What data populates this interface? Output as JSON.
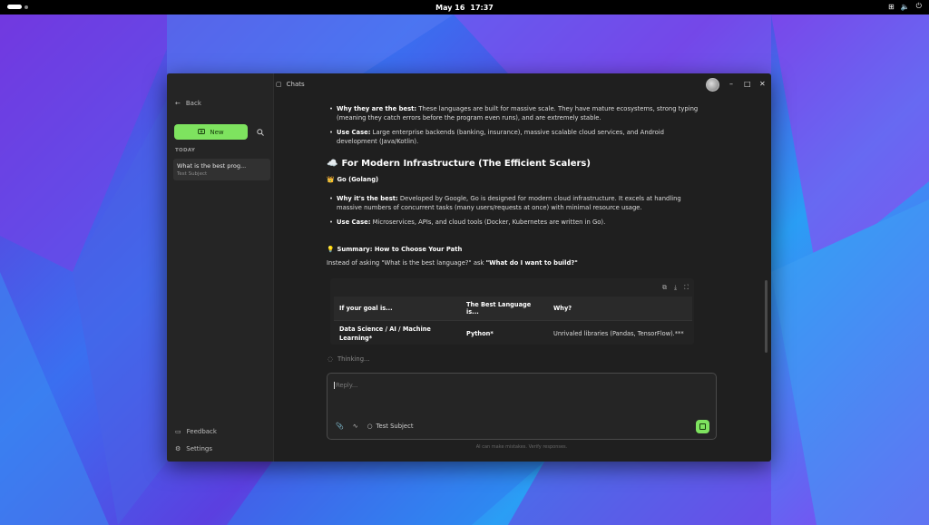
{
  "system": {
    "date": "May 16",
    "time": "17:37"
  },
  "sidebar": {
    "back_label": "Back",
    "new_label": "New",
    "section_today": "TODAY",
    "chats": [
      {
        "title": "What is the best prog...",
        "subtitle": "Test Subject"
      }
    ],
    "feedback_label": "Feedback",
    "settings_label": "Settings"
  },
  "header": {
    "title": "Chats"
  },
  "message": {
    "bullet1_bold": "Why they are the best:",
    "bullet1_text": " These languages are built for massive scale. They have mature ecosystems, strong typing (meaning they catch errors before the program even runs), and are extremely stable.",
    "bullet2_bold": "Use Case:",
    "bullet2_text": " Large enterprise backends (banking, insurance), massive scalable cloud services, and Android development (Java/Kotlin).",
    "heading2_emoji": "☁️",
    "heading2": "For Modern Infrastructure (The Efficient Scalers)",
    "heading3_emoji": "👑",
    "heading3": "Go (Golang)",
    "bullet3_bold": "Why it's the best:",
    "bullet3_text": " Developed by Google, Go is designed for modern cloud infrastructure. It excels at handling massive numbers of concurrent tasks (many users/requests at once) with minimal resource usage.",
    "bullet4_bold": "Use Case:",
    "bullet4_text": " Microservices, APIs, and cloud tools (Docker, Kubernetes are written in Go).",
    "summary_emoji": "💡",
    "summary_heading": "Summary: How to Choose Your Path",
    "summary_text": "Instead of asking \"What is the best language?\" ask ",
    "summary_bold": "\"What do I want to build?\""
  },
  "table": {
    "headers": [
      "If your goal is...",
      "The Best Language is...",
      "Why?"
    ],
    "rows": [
      [
        "Data Science / AI / Machine Learning*",
        "Python*",
        "Unrivaled libraries (Pandas, TensorFlow).***"
      ]
    ]
  },
  "status": {
    "thinking": "Thinking..."
  },
  "composer": {
    "placeholder": "Reply...",
    "subject": "Test Subject",
    "disclaimer": "AI can make mistakes. Verify responses."
  },
  "colors": {
    "accent": "#7ee35f",
    "window_bg": "#1f1f1f",
    "sidebar_bg": "#252525"
  }
}
